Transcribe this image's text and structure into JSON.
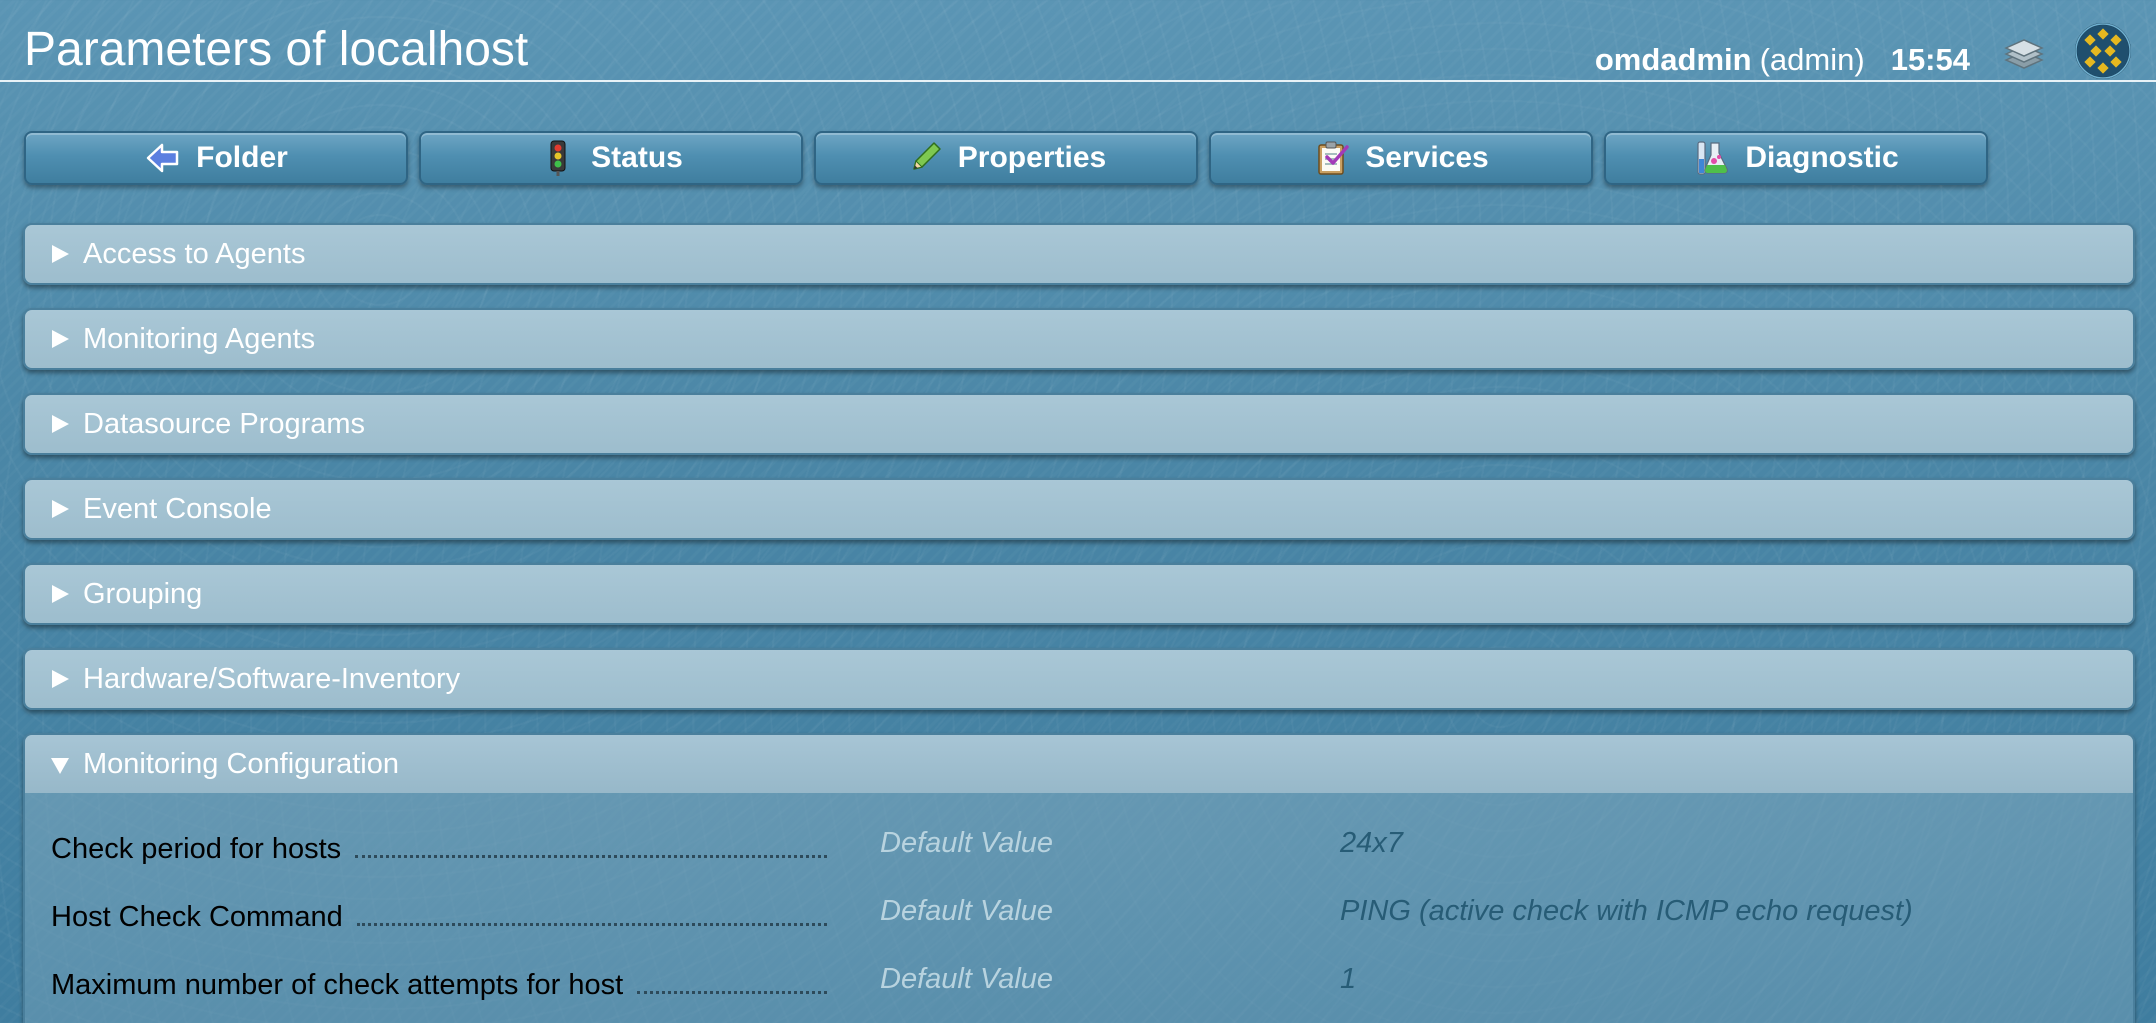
{
  "header": {
    "title": "Parameters of localhost",
    "user": "omdadmin",
    "role": "(admin)",
    "time": "15:54"
  },
  "buttons": [
    {
      "label": "Folder",
      "icon": "back-arrow-icon"
    },
    {
      "label": "Status",
      "icon": "traffic-light-icon"
    },
    {
      "label": "Properties",
      "icon": "pencil-icon"
    },
    {
      "label": "Services",
      "icon": "clipboard-check-icon"
    },
    {
      "label": "Diagnostic",
      "icon": "flask-icon"
    }
  ],
  "sections": [
    {
      "title": "Access to Agents",
      "state": "collapsed"
    },
    {
      "title": "Monitoring Agents",
      "state": "collapsed"
    },
    {
      "title": "Datasource Programs",
      "state": "collapsed"
    },
    {
      "title": "Event Console",
      "state": "collapsed"
    },
    {
      "title": "Grouping",
      "state": "collapsed"
    },
    {
      "title": "Hardware/Software-Inventory",
      "state": "collapsed"
    },
    {
      "title": "Monitoring Configuration",
      "state": "expanded"
    }
  ],
  "monitoring_configuration": {
    "rows": [
      {
        "label": "Check period for hosts",
        "default": "Default Value",
        "value": "24x7"
      },
      {
        "label": "Host Check Command",
        "default": "Default Value",
        "value": "PING (active check with ICMP echo request)"
      },
      {
        "label": "Maximum number of check attempts for host",
        "default": "Default Value",
        "value": "1"
      }
    ]
  },
  "colors": {
    "background": "#4e88a8",
    "section_header": "#a9c7d6",
    "value_text": "#275c76",
    "default_text": "#b8d3df"
  }
}
